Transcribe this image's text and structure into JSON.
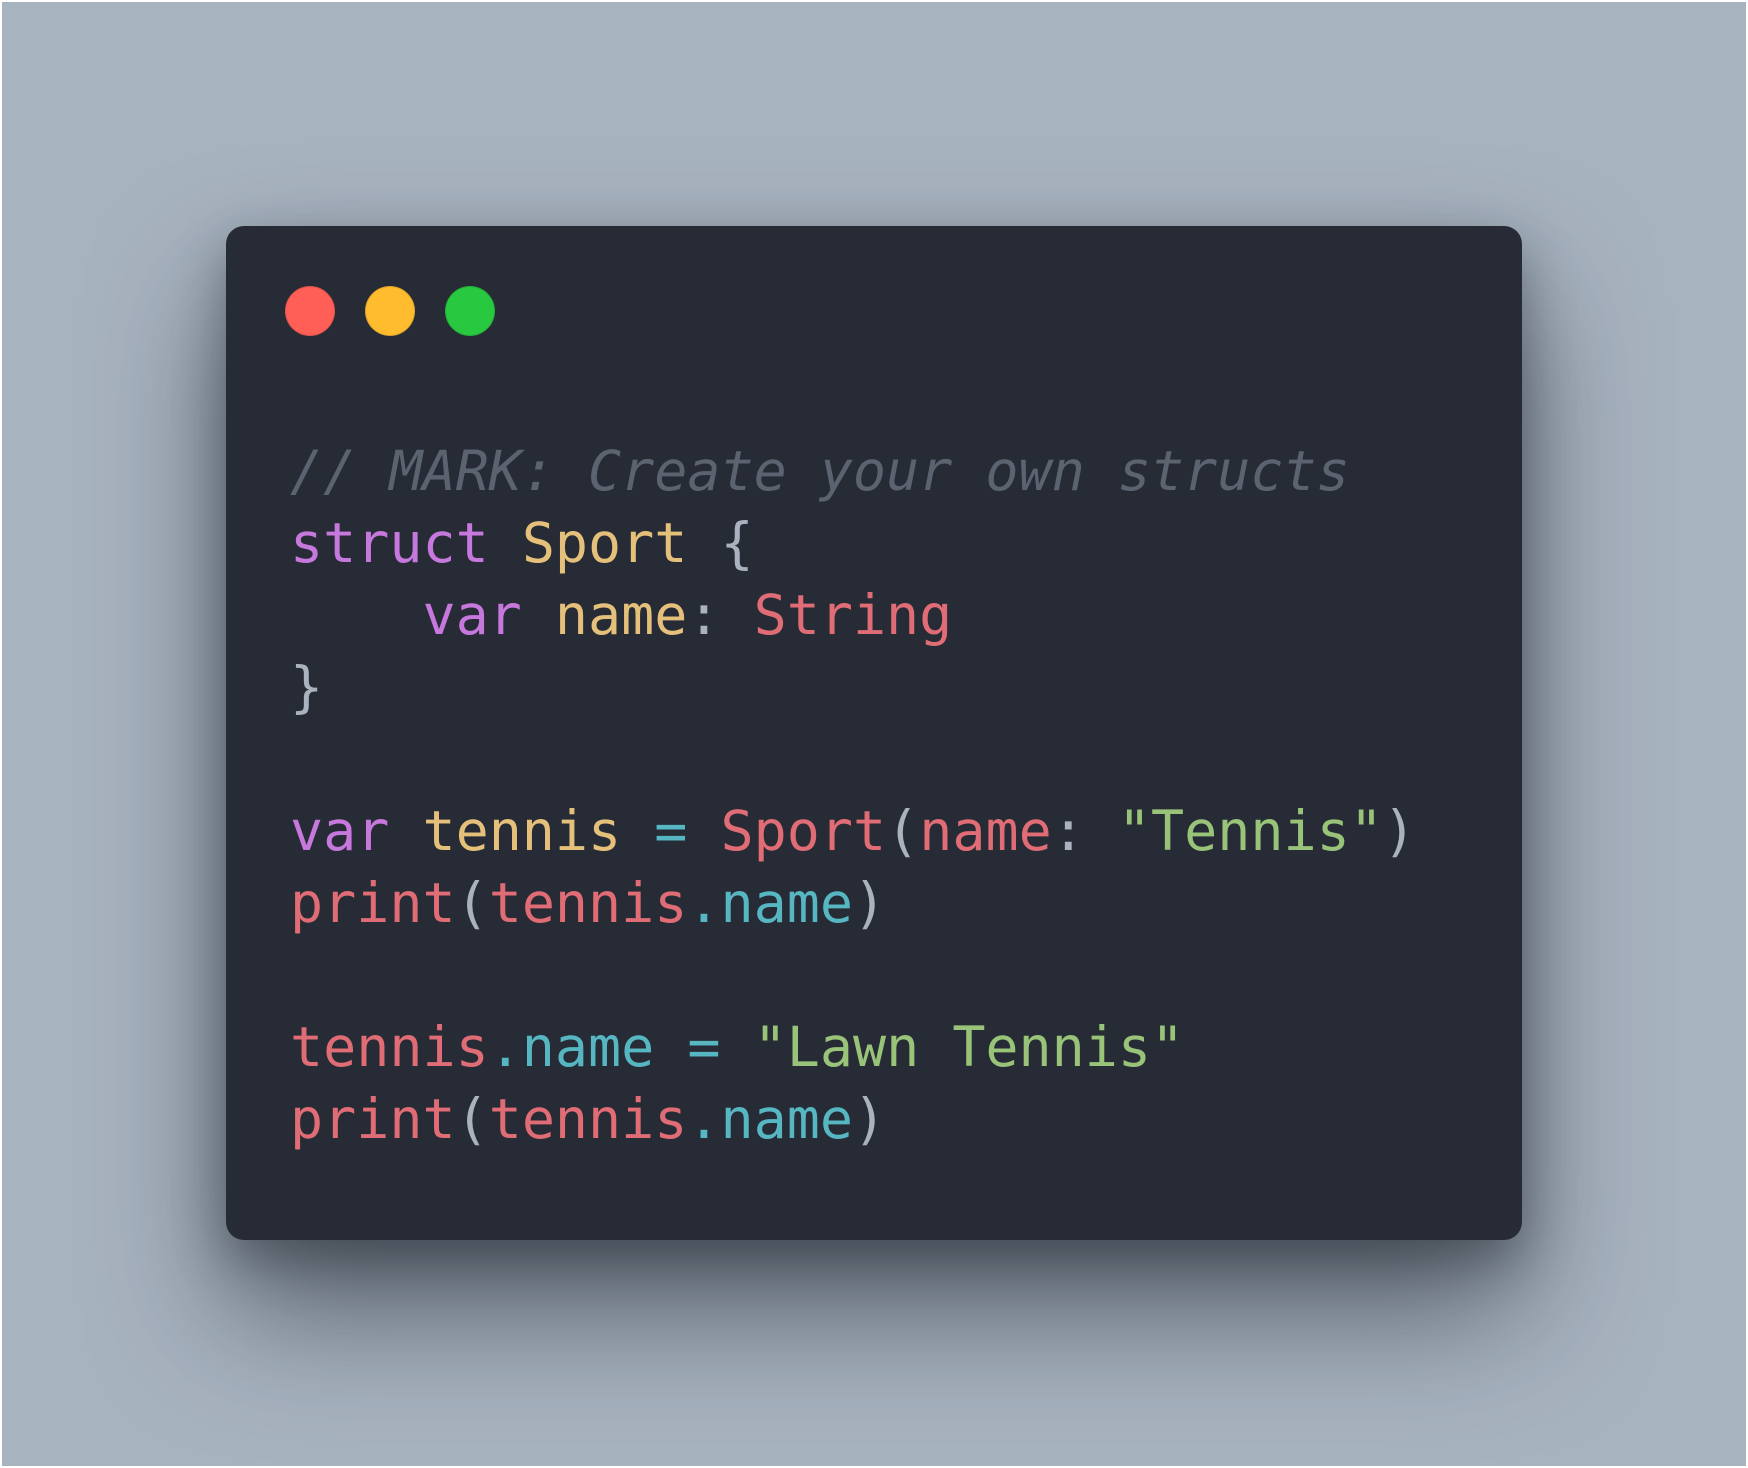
{
  "colors": {
    "backdrop": "#a7b3bf",
    "window": "#272b35",
    "traffic_close": "#ff5f57",
    "traffic_minimize": "#febc2e",
    "traffic_zoom": "#28c840",
    "comment": "#5c6370",
    "keyword": "#c678dd",
    "type_name": "#e5c07b",
    "identifier": "#e06c75",
    "property": "#56b6c2",
    "string": "#98c379",
    "punctuation": "#abb2bf"
  },
  "window": {
    "traffic_lights": [
      {
        "name": "close",
        "color": "#ff5f57"
      },
      {
        "name": "minimize",
        "color": "#febc2e"
      },
      {
        "name": "zoom",
        "color": "#28c840"
      }
    ]
  },
  "code": {
    "lines": [
      [
        {
          "text": "// MARK: Create your own structs",
          "kind": "comment"
        }
      ],
      [
        {
          "text": "struct",
          "kind": "keyword"
        },
        {
          "text": " ",
          "kind": "punctuation"
        },
        {
          "text": "Sport",
          "kind": "type_name"
        },
        {
          "text": " {",
          "kind": "punctuation"
        }
      ],
      [
        {
          "text": "    ",
          "kind": "punctuation"
        },
        {
          "text": "var",
          "kind": "keyword"
        },
        {
          "text": " ",
          "kind": "punctuation"
        },
        {
          "text": "name",
          "kind": "type_name"
        },
        {
          "text": ": ",
          "kind": "punctuation"
        },
        {
          "text": "String",
          "kind": "identifier"
        }
      ],
      [
        {
          "text": "}",
          "kind": "punctuation"
        }
      ],
      [],
      [
        {
          "text": "var",
          "kind": "keyword"
        },
        {
          "text": " ",
          "kind": "punctuation"
        },
        {
          "text": "tennis",
          "kind": "type_name"
        },
        {
          "text": " ",
          "kind": "punctuation"
        },
        {
          "text": "=",
          "kind": "property"
        },
        {
          "text": " ",
          "kind": "punctuation"
        },
        {
          "text": "Sport",
          "kind": "identifier"
        },
        {
          "text": "(",
          "kind": "punctuation"
        },
        {
          "text": "name",
          "kind": "identifier"
        },
        {
          "text": ": ",
          "kind": "punctuation"
        },
        {
          "text": "\"Tennis\"",
          "kind": "string"
        },
        {
          "text": ")",
          "kind": "punctuation"
        }
      ],
      [
        {
          "text": "print",
          "kind": "identifier"
        },
        {
          "text": "(",
          "kind": "punctuation"
        },
        {
          "text": "tennis",
          "kind": "identifier"
        },
        {
          "text": ".name",
          "kind": "property"
        },
        {
          "text": ")",
          "kind": "punctuation"
        }
      ],
      [],
      [
        {
          "text": "tennis",
          "kind": "identifier"
        },
        {
          "text": ".name",
          "kind": "property"
        },
        {
          "text": " ",
          "kind": "punctuation"
        },
        {
          "text": "=",
          "kind": "property"
        },
        {
          "text": " ",
          "kind": "punctuation"
        },
        {
          "text": "\"Lawn Tennis\"",
          "kind": "string"
        }
      ],
      [
        {
          "text": "print",
          "kind": "identifier"
        },
        {
          "text": "(",
          "kind": "punctuation"
        },
        {
          "text": "tennis",
          "kind": "identifier"
        },
        {
          "text": ".name",
          "kind": "property"
        },
        {
          "text": ")",
          "kind": "punctuation"
        }
      ]
    ]
  }
}
